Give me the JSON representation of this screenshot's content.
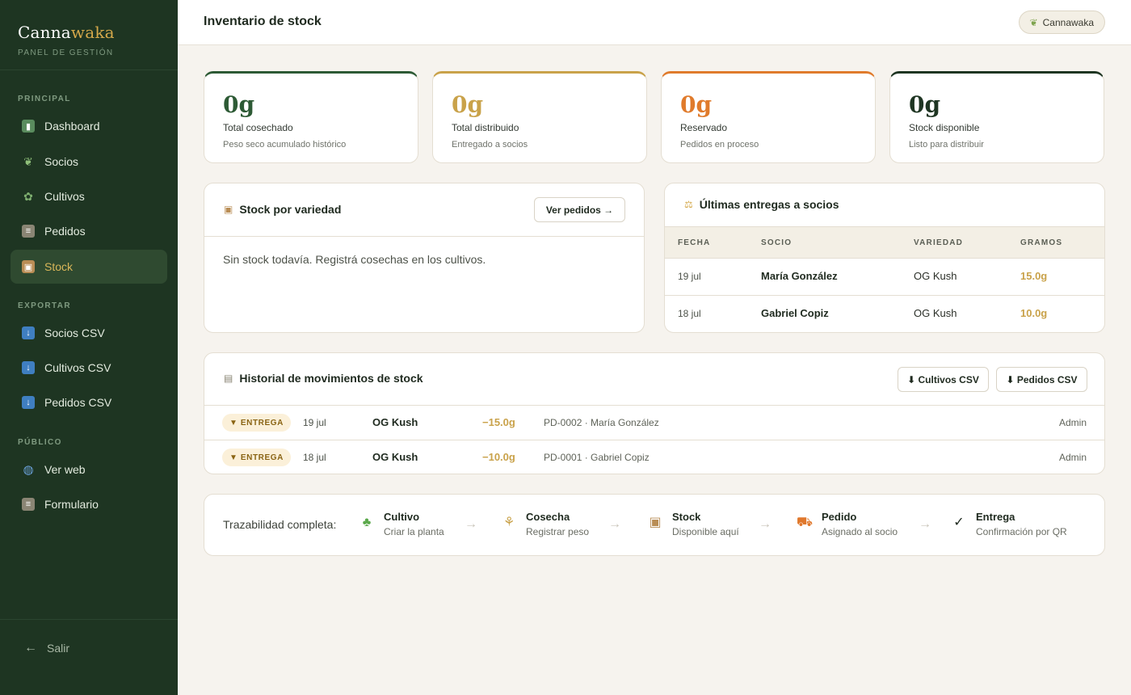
{
  "sidebar": {
    "brand_first": "Canna",
    "brand_second": "waka",
    "brand_sub": "PANEL DE GESTIÓN",
    "sections": {
      "principal": "PRINCIPAL",
      "exportar": "EXPORTAR",
      "publico": "PÚBLICO"
    },
    "items": [
      {
        "label": "Dashboard",
        "icon": "bar-chart-icon"
      },
      {
        "label": "Socios",
        "icon": "leaf-icon"
      },
      {
        "label": "Cultivos",
        "icon": "potted-plant-icon"
      },
      {
        "label": "Pedidos",
        "icon": "clipboard-icon"
      },
      {
        "label": "Stock",
        "icon": "package-icon",
        "active": true
      },
      {
        "label": "Socios CSV",
        "icon": "download-icon"
      },
      {
        "label": "Cultivos CSV",
        "icon": "download-icon"
      },
      {
        "label": "Pedidos CSV",
        "icon": "download-icon"
      },
      {
        "label": "Ver web",
        "icon": "globe-icon"
      },
      {
        "label": "Formulario",
        "icon": "clipboard-icon"
      }
    ],
    "logout": "Salir"
  },
  "topbar": {
    "title": "Inventario de stock",
    "user": "Cannawaka"
  },
  "stats": [
    {
      "value": "0g",
      "label": "Total cosechado",
      "sub": "Peso seco acumulado histórico",
      "color": "#2d5a35"
    },
    {
      "value": "0g",
      "label": "Total distribuido",
      "sub": "Entregado a socios",
      "color": "#c9a24a"
    },
    {
      "value": "0g",
      "label": "Reservado",
      "sub": "Pedidos en proceso",
      "color": "#e07b2c"
    },
    {
      "value": "0g",
      "label": "Stock disponible",
      "sub": "Listo para distribuir",
      "color": "#1e3522"
    }
  ],
  "stock_panel": {
    "title": "Stock por variedad",
    "button": "Ver pedidos →",
    "empty": "Sin stock todavía. Registrá cosechas en los cultivos."
  },
  "deliveries": {
    "title": "Últimas entregas a socios",
    "headers": [
      "FECHA",
      "SOCIO",
      "VARIEDAD",
      "GRAMOS"
    ],
    "rows": [
      {
        "date": "19 jul",
        "member": "María González",
        "variety": "OG Kush",
        "grams": "15.0g"
      },
      {
        "date": "18 jul",
        "member": "Gabriel Copiz",
        "variety": "OG Kush",
        "grams": "10.0g"
      }
    ]
  },
  "history": {
    "title": "Historial de movimientos de stock",
    "btn_cultivos": "⬇ Cultivos CSV",
    "btn_pedidos": "⬇ Pedidos CSV",
    "rows": [
      {
        "type": "▼ ENTREGA",
        "date": "19 jul",
        "variety": "OG Kush",
        "amount": "−15.0g",
        "ref": "PD-0002 · María González",
        "user": "Admin"
      },
      {
        "type": "▼ ENTREGA",
        "date": "18 jul",
        "variety": "OG Kush",
        "amount": "−10.0g",
        "ref": "PD-0001 · Gabriel Copiz",
        "user": "Admin"
      }
    ]
  },
  "trace": {
    "label": "Trazabilidad completa:",
    "steps": [
      {
        "name": "Cultivo",
        "sub": "Criar la planta",
        "icon": "seedling-icon"
      },
      {
        "name": "Cosecha",
        "sub": "Registrar peso",
        "icon": "harvest-icon"
      },
      {
        "name": "Stock",
        "sub": "Disponible aquí",
        "icon": "package-icon"
      },
      {
        "name": "Pedido",
        "sub": "Asignado al socio",
        "icon": "truck-icon"
      },
      {
        "name": "Entrega",
        "sub": "Confirmación por QR",
        "icon": "check-icon"
      }
    ],
    "arrow": "→"
  },
  "colors": {
    "sidebar_bg": "#1e3522",
    "accent_gold": "#c9a24a",
    "active_text": "#d9b659",
    "background": "#f6f3ee"
  }
}
